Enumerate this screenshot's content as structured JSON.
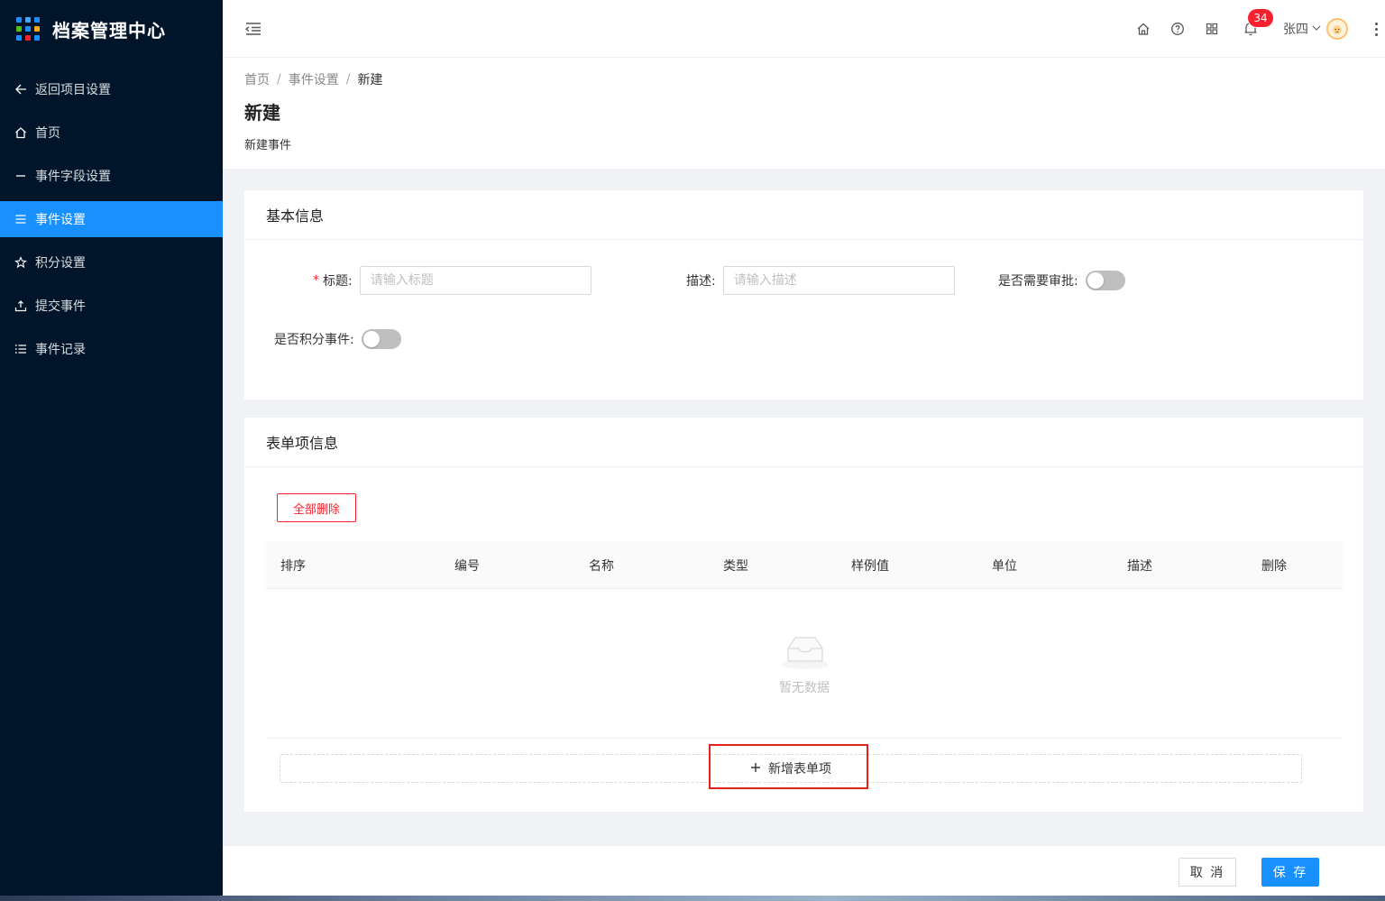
{
  "app": {
    "title": "档案管理中心",
    "icon": "apps-grid-icon"
  },
  "sidebar": {
    "items": [
      {
        "label": "返回项目设置",
        "icon": "arrow-left-icon",
        "active": false
      },
      {
        "label": "首页",
        "icon": "home-icon",
        "active": false
      },
      {
        "label": "事件字段设置",
        "icon": "minus-icon",
        "active": false
      },
      {
        "label": "事件设置",
        "icon": "list-icon",
        "active": true
      },
      {
        "label": "积分设置",
        "icon": "star-icon",
        "active": false
      },
      {
        "label": "提交事件",
        "icon": "upload-icon",
        "active": false
      },
      {
        "label": "事件记录",
        "icon": "ordered-list-icon",
        "active": false
      }
    ]
  },
  "header": {
    "icons": [
      "menu-fold-icon",
      "home-icon",
      "question-icon",
      "appstore-icon",
      "bell-icon",
      "more-icon"
    ],
    "notification_count": "34",
    "user_name": "张四"
  },
  "breadcrumb": {
    "items": [
      "首页",
      "事件设置"
    ],
    "current": "新建"
  },
  "page": {
    "title": "新建",
    "description": "新建事件"
  },
  "basic_info": {
    "title": "基本信息",
    "fields": {
      "title_label": "标题:",
      "title_required": "*",
      "title_placeholder": "请输入标题",
      "desc_label": "描述:",
      "desc_placeholder": "请输入描述",
      "approval_label": "是否需要审批:",
      "approval_on": false,
      "points_label": "是否积分事件:",
      "points_on": false
    }
  },
  "form_items": {
    "title": "表单项信息",
    "delete_all_label": "全部删除",
    "columns": [
      "排序",
      "编号",
      "名称",
      "类型",
      "样例值",
      "单位",
      "描述",
      "删除"
    ],
    "rows": [],
    "empty_text": "暂无数据",
    "add_label": "新增表单项"
  },
  "footer": {
    "cancel_label": "取 消",
    "save_label": "保 存"
  },
  "colors": {
    "sidebar_bg": "#001529",
    "primary": "#1890ff",
    "danger": "#f5222d",
    "highlight": "#e8201a"
  }
}
